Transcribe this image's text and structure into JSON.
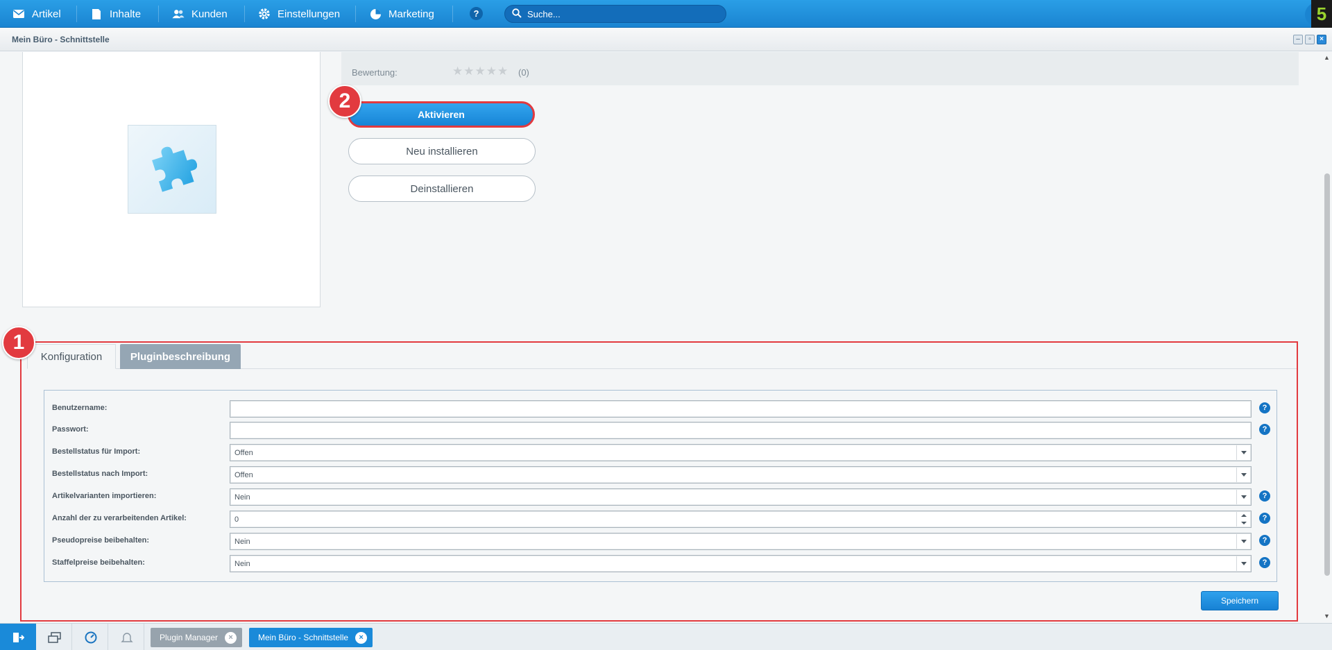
{
  "topbar": {
    "menu": [
      {
        "label": "Artikel",
        "icon": "mail-icon"
      },
      {
        "label": "Inhalte",
        "icon": "document-icon"
      },
      {
        "label": "Kunden",
        "icon": "users-icon"
      },
      {
        "label": "Einstellungen",
        "icon": "gear-icon"
      },
      {
        "label": "Marketing",
        "icon": "pie-chart-icon"
      }
    ],
    "help_label": "?",
    "search_placeholder": "Suche..."
  },
  "window": {
    "title": "Mein Büro - Schnittstelle"
  },
  "plugin": {
    "rating_label": "Bewertung:",
    "stars": "★★★★★",
    "rating_count": "(0)",
    "activate_label": "Aktivieren",
    "reinstall_label": "Neu installieren",
    "uninstall_label": "Deinstallieren"
  },
  "markers": {
    "one": "1",
    "two": "2"
  },
  "tabs": {
    "config": "Konfiguration",
    "description": "Pluginbeschreibung"
  },
  "form": {
    "fields": [
      {
        "label": "Benutzername:",
        "type": "text",
        "value": "",
        "help": "?"
      },
      {
        "label": "Passwort:",
        "type": "text",
        "value": "",
        "help": "?"
      },
      {
        "label": "Bestellstatus für Import:",
        "type": "select",
        "value": "Offen",
        "help": ""
      },
      {
        "label": "Bestellstatus nach Import:",
        "type": "select",
        "value": "Offen",
        "help": ""
      },
      {
        "label": "Artikelvarianten importieren:",
        "type": "select",
        "value": "Nein",
        "help": "?"
      },
      {
        "label": "Anzahl der zu verarbeitenden Artikel:",
        "type": "number",
        "value": "0",
        "help": "?"
      },
      {
        "label": "Pseudopreise beibehalten:",
        "type": "select",
        "value": "Nein",
        "help": "?"
      },
      {
        "label": "Staffelpreise beibehalten:",
        "type": "select",
        "value": "Nein",
        "help": "?"
      }
    ],
    "save_label": "Speichern"
  },
  "taskbar": {
    "tabs": [
      {
        "label": "Plugin Manager",
        "active": false
      },
      {
        "label": "Mein Büro - Schnittstelle",
        "active": true
      }
    ]
  },
  "colors": {
    "accent": "#1a84d1",
    "marker": "#e23a3f",
    "inactive_tab": "#95a6b4"
  }
}
